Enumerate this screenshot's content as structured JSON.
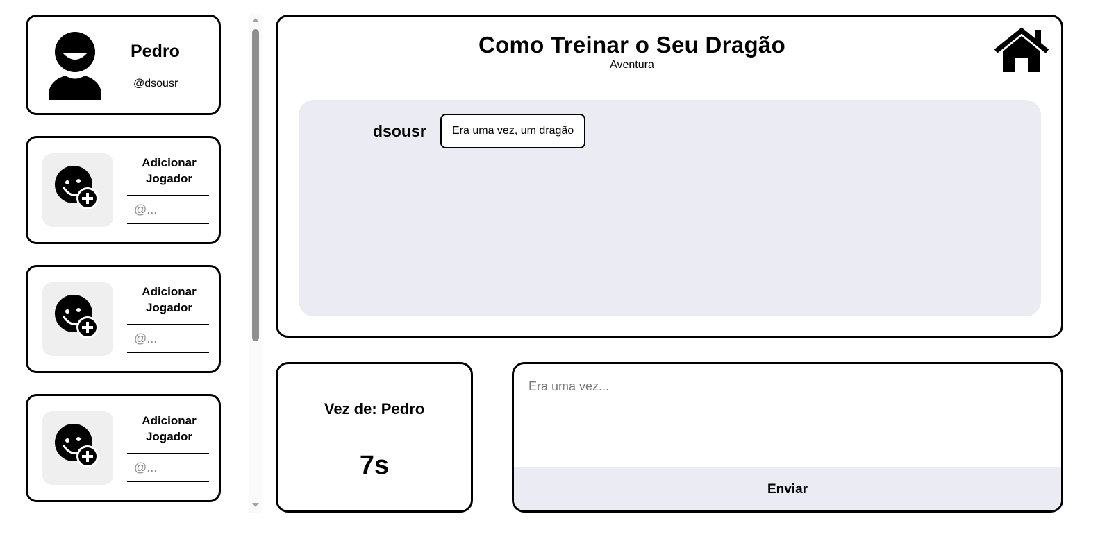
{
  "profile": {
    "name": "Pedro",
    "handle": "@dsousr",
    "icon": "user-avatar-icon"
  },
  "add_player_slots": [
    {
      "title": "Adicionar Jogador",
      "placeholder": "@...",
      "icon": "add-user-icon"
    },
    {
      "title": "Adicionar Jogador",
      "placeholder": "@...",
      "icon": "add-user-icon"
    },
    {
      "title": "Adicionar Jogador",
      "placeholder": "@...",
      "icon": "add-user-icon"
    }
  ],
  "story": {
    "title": "Como Treinar o Seu Dragão",
    "genre": "Aventura",
    "home_icon": "home-icon",
    "entries": [
      {
        "author": "dsousr",
        "text": "Era uma vez, um dragão"
      }
    ]
  },
  "turn": {
    "label": "Vez de: Pedro",
    "timer": "7s"
  },
  "compose": {
    "placeholder": "Era uma vez...",
    "send_label": "Enviar"
  },
  "colors": {
    "border": "#000000",
    "story_background": "#ebebf3",
    "avatar_box_background": "#efefef",
    "send_background": "#ebebf3"
  }
}
